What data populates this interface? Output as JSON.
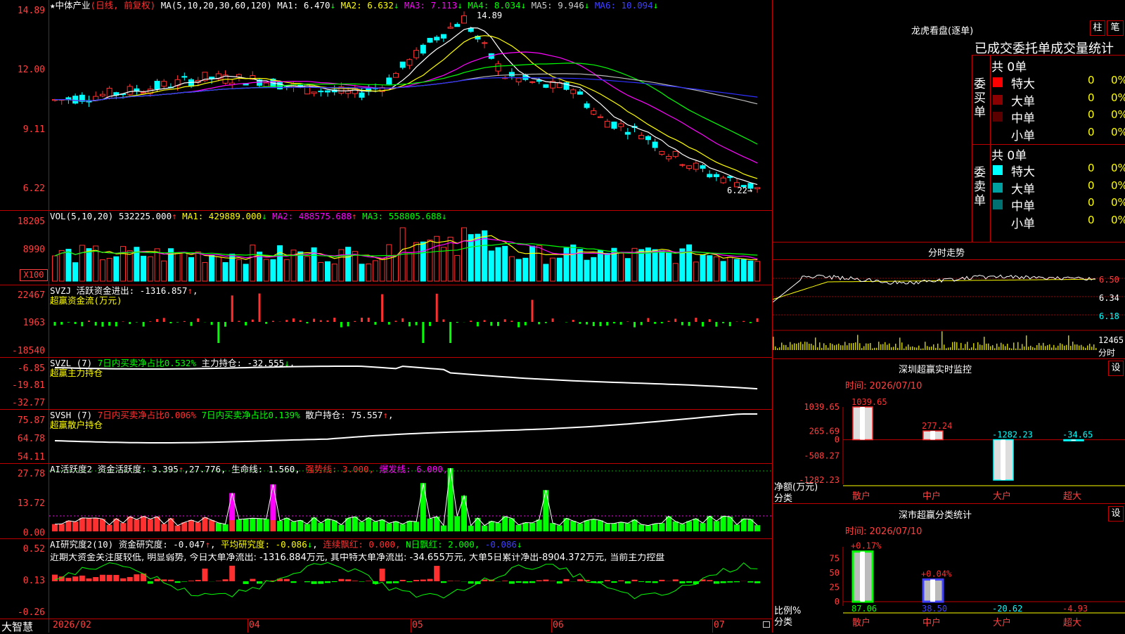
{
  "stock": {
    "name_star": "★",
    "name": "中体产业",
    "mode": "(日线, 前复权)"
  },
  "price_panel": {
    "ma_header": [
      {
        "label": "MA(5,10,20,30,60,120)",
        "color": "#ffffff"
      },
      {
        "label": "MA1: 6.470",
        "color": "#ffffff",
        "arrow": "↓",
        "arrow_color": "#00ff00"
      },
      {
        "label": "MA2: 6.632",
        "color": "#ffff00",
        "arrow": "↓",
        "arrow_color": "#00ff00"
      },
      {
        "label": "MA3: 7.113",
        "color": "#ff00ff",
        "arrow": "↓",
        "arrow_color": "#00ff00"
      },
      {
        "label": "MA4: 8.034",
        "color": "#00ff00",
        "arrow": "↓",
        "arrow_color": "#00ff00"
      },
      {
        "label": "MA5: 9.946",
        "color": "#cccccc",
        "arrow": "↓",
        "arrow_color": "#00ff00"
      },
      {
        "label": "MA6: 10.094",
        "color": "#4040ff",
        "arrow": "↓",
        "arrow_color": "#00ff00"
      }
    ],
    "y_ticks": [
      "14.89",
      "12.00",
      "9.11",
      "6.22"
    ],
    "high_label": "14.89",
    "low_label": "6.22→"
  },
  "vol_panel": {
    "header": [
      {
        "label": "VOL(5,10,20)",
        "color": "#ffffff"
      },
      {
        "label": "532225.000",
        "color": "#ffffff",
        "arrow": "↑",
        "arrow_color": "#ff3030"
      },
      {
        "label": "MA1: 429889.000",
        "color": "#ffff00",
        "arrow": "↓",
        "arrow_color": "#00ff00"
      },
      {
        "label": "MA2: 488575.688",
        "color": "#ff00ff",
        "arrow": "↑",
        "arrow_color": "#ff3030"
      },
      {
        "label": "MA3: 558805.688",
        "color": "#00ff00",
        "arrow": "↓",
        "arrow_color": "#00ff00"
      }
    ],
    "y_ticks": [
      "18205",
      "8990"
    ],
    "unit": "X100"
  },
  "svzj_panel": {
    "line1": "SVZJ  活跃资金进出: -1316.857",
    "line1_arrow": "↑",
    "line1_tail": ",",
    "line2": "超赢资金流(万元)",
    "y_ticks": [
      "22467",
      "1963",
      "-18540"
    ]
  },
  "svzl_panel": {
    "h1": "SVZL (7)",
    "h2": "7日内买卖净占比0.532%",
    "h3": "主力持仓: -32.555",
    "h3_arrow": "↓",
    "h3_tail": ",",
    "line2": "超赢主力持仓",
    "y_ticks": [
      "-6.85",
      "-19.81",
      "-32.77"
    ]
  },
  "svsh_panel": {
    "h1": "SVSH (7)",
    "h2": "7日内买卖净占比0.006%",
    "h3": "7日内买卖净占比0.139%",
    "h4": "散户持仓: 75.557",
    "h4_arrow": "↑",
    "h4_tail": ",",
    "line2": "超赢散户持仓",
    "y_ticks": [
      "75.87",
      "64.78",
      "54.11"
    ]
  },
  "ai_active_panel": {
    "h1": "AI活跃度2",
    "h2": "资金活跃度: 3.395",
    "h2_arrow": "↑",
    "h3": ",27.776,",
    "h4": "生命线: 1.560,",
    "h5": "强势线: 3.000,",
    "h6": "爆发线: 6.000,",
    "y_ticks": [
      "27.78",
      "13.72",
      "0.00"
    ]
  },
  "ai_research_panel": {
    "h1": "AI研究度2(10)",
    "h2": "资金研究度: -0.047",
    "h2_arrow": "↑",
    "h3": ",",
    "h4": "平均研究度: -0.086",
    "h4_arrow": "↓",
    "h5": ",",
    "h6": "连续飘红: 0.000,",
    "h7": "N日飘红: 2.000,",
    "h8": "-0.086",
    "h8_arrow": "↓",
    "comment": "近期大资金关注度较低, 明显弱势, 今日大单净流出: -1316.884万元, 其中特大单净流出: -34.655万元, 大单5日累计净出-8904.372万元, 当前主力控盘",
    "y_ticks": [
      "0.52",
      "0.13",
      "-0.26"
    ]
  },
  "x_axis": {
    "labels": [
      "2026/02",
      "04",
      "05",
      "06",
      "07"
    ],
    "brand": "大智慧"
  },
  "dragon_tiger": {
    "title": "龙虎看盘(逐单)",
    "btn1": "柱",
    "btn2": "笔",
    "subtitle": "已成交委托单成交量统计",
    "buy_header": "委买单",
    "sell_header": "委卖单",
    "buy_total": "共 0单",
    "sell_total": "共 0单",
    "buy_rows": [
      {
        "label": "特大",
        "qty": "0",
        "pct": "0%",
        "color": "#ff0000"
      },
      {
        "label": "大单",
        "qty": "0",
        "pct": "0%",
        "color": "#8b0000"
      },
      {
        "label": "中单",
        "qty": "0",
        "pct": "0%",
        "color": "#5a0000"
      },
      {
        "label": "小单",
        "qty": "0",
        "pct": "0%",
        "color": "#000000"
      }
    ],
    "sell_rows": [
      {
        "label": "特大",
        "qty": "0",
        "pct": "0%",
        "color": "#00ffff"
      },
      {
        "label": "大单",
        "qty": "0",
        "pct": "0%",
        "color": "#00a0a0"
      },
      {
        "label": "中单",
        "qty": "0",
        "pct": "0%",
        "color": "#007070"
      },
      {
        "label": "小单",
        "qty": "0",
        "pct": "0%",
        "color": "#000000"
      }
    ]
  },
  "intraday": {
    "title": "分时走势",
    "y_ticks": [
      "6.50",
      "6.34",
      "6.18"
    ],
    "vol_label": "12465",
    "vol_unit": "分时"
  },
  "sz_monitor": {
    "title": "深圳超赢实时监控",
    "settings": "设",
    "time": "时间: 2026/07/10",
    "y_ticks": [
      "1039.65",
      "265.69",
      "0",
      "-508.27",
      "-1282.23"
    ],
    "ylabel1": "净额(万元)",
    "ylabel2": "分类",
    "categories": [
      "散户",
      "中户",
      "大户",
      "超大"
    ],
    "values": [
      1039.65,
      277.24,
      -1282.23,
      -34.65
    ],
    "value_labels": [
      "1039.65",
      "277.24",
      "-1282.23",
      "-34.65"
    ]
  },
  "sz_class": {
    "title": "深市超赢分类统计",
    "settings": "设",
    "time": "时间: 2026/07/10",
    "y_ticks": [
      "75",
      "50",
      "25",
      "0"
    ],
    "ylabel1": "比例%",
    "ylabel2": "分类",
    "categories": [
      "散户",
      "中户",
      "大户",
      "超大"
    ],
    "top_labels": [
      "+0.17%",
      "+0.04%"
    ],
    "values": [
      87.06,
      38.5,
      -20.62,
      -4.93
    ],
    "value_labels": [
      "87.06",
      "38.50",
      "-20.62",
      "-4.93"
    ]
  }
}
